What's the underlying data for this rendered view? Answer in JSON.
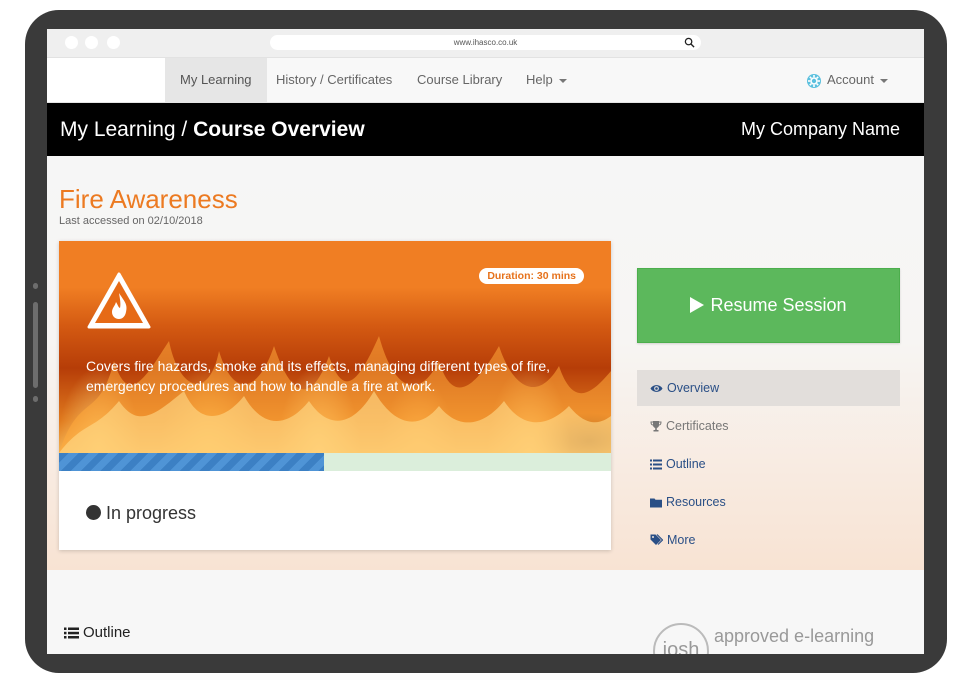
{
  "browser": {
    "url": "www.ihasco.co.uk",
    "search_icon": "search-icon"
  },
  "nav": {
    "items": [
      {
        "label": "My Learning",
        "active": true
      },
      {
        "label": "History / Certificates"
      },
      {
        "label": "Course Library"
      },
      {
        "label": "Help"
      }
    ],
    "account_label": "Account",
    "account_icon": "account-gear-icon"
  },
  "header": {
    "breadcrumb_prefix": "My Learning / ",
    "breadcrumb_current": "Course Overview",
    "company": "My Company Name"
  },
  "course": {
    "title": "Fire Awareness",
    "last_accessed": "Last accessed on 02/10/2018",
    "duration": "Duration: 30 mins",
    "description": "Covers fire hazards, smoke and its effects, managing different types of fire, emergency procedures and how to handle a fire at work.",
    "progress_fraction": 0.48,
    "status": "In progress"
  },
  "actions": {
    "resume_label": "Resume Session"
  },
  "side_menu": {
    "items": [
      {
        "label": "Overview",
        "icon": "eye-icon",
        "active": true
      },
      {
        "label": "Certificates",
        "icon": "trophy-icon"
      },
      {
        "label": "Outline",
        "icon": "list-icon"
      },
      {
        "label": "Resources",
        "icon": "folder-icon"
      },
      {
        "label": "More",
        "icon": "tags-icon"
      }
    ]
  },
  "lower": {
    "outline_heading": "Outline",
    "logo_text": "josh",
    "approved_text": "approved e-learning"
  },
  "colors": {
    "accent_orange": "#ec7a21",
    "resume_green": "#5cb85c",
    "progress_blue": "#3c80c4",
    "link_blue": "#2a4f86"
  }
}
